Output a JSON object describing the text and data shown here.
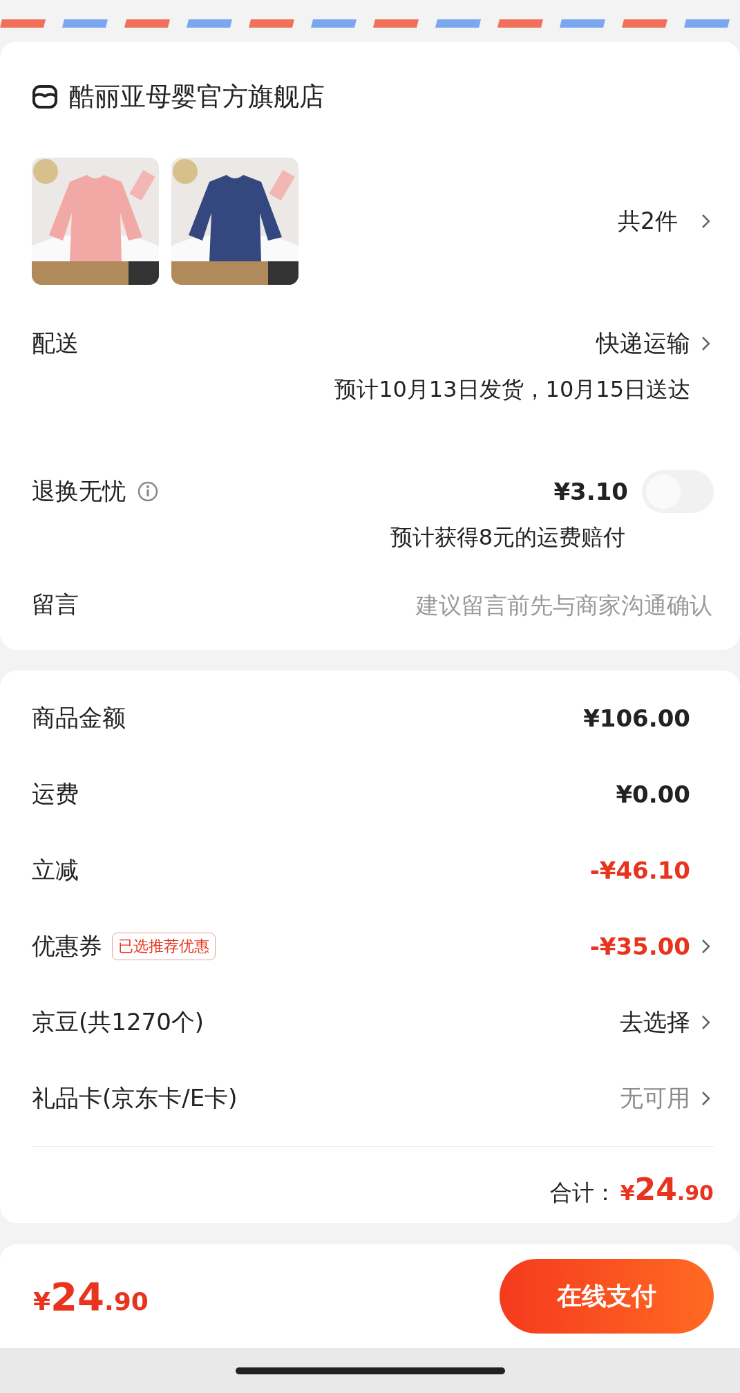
{
  "store": {
    "name": "酷丽亚母婴官方旗舰店"
  },
  "item_count": "共2件",
  "delivery": {
    "label": "配送",
    "method": "快递运输",
    "estimate": "预计10月13日发货，10月15日送达"
  },
  "return_insurance": {
    "label": "退换无忧",
    "price": "¥3.10",
    "on": false,
    "note": "预计获得8元的运费赔付"
  },
  "message": {
    "label": "留言",
    "placeholder": "建议留言前先与商家沟通确认"
  },
  "fees": [
    {
      "label": "商品金额",
      "value": "¥106.00",
      "color": "#222222",
      "arrow": false
    },
    {
      "label": "运费",
      "value": "¥0.00",
      "color": "#222222",
      "arrow": false
    },
    {
      "label": "立减",
      "value": "-¥46.10",
      "color": "#e8341f",
      "arrow": false
    },
    {
      "label": "优惠券",
      "badge": "已选推荐优惠",
      "value": "-¥35.00",
      "color": "#e8341f",
      "arrow": true
    },
    {
      "label": "京豆(共1270个)",
      "value": "去选择",
      "color": "#222222",
      "arrow": true
    },
    {
      "label": "礼品卡(京东卡/E卡)",
      "value": "无可用",
      "color": "#8a8a8a",
      "arrow": true
    }
  ],
  "total": {
    "label": "合计：",
    "currency": "¥",
    "integer": "24",
    "decimal": ".90"
  },
  "footer": {
    "currency": "¥",
    "integer": "24",
    "decimal": ".90",
    "button": "在线支付"
  }
}
